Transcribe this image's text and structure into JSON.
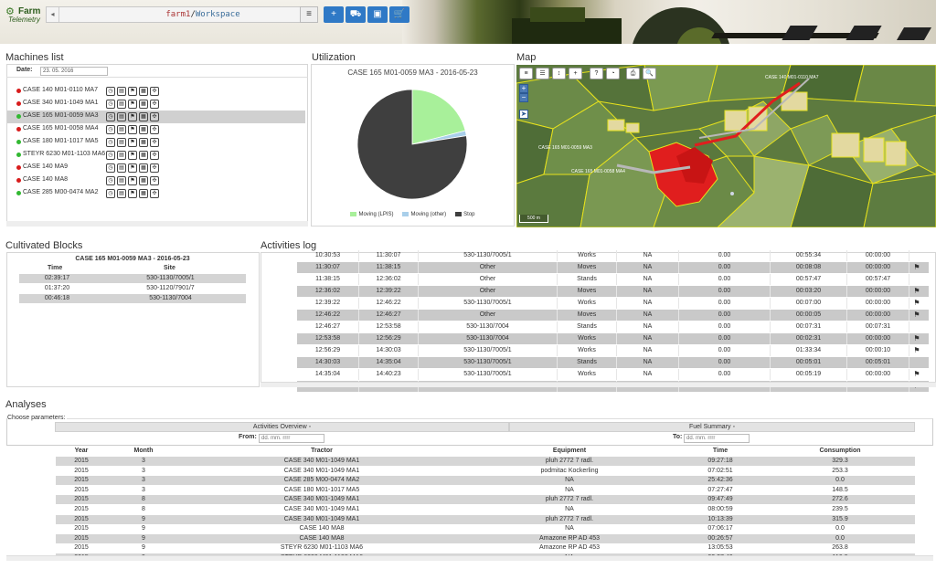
{
  "header": {
    "logo_top": "Farm",
    "logo_bottom": "Telemetry",
    "path_part1": "farm1",
    "path_sep": "/",
    "path_part2": "Workspace",
    "back_glyph": "◂",
    "menu_glyph": "≡",
    "buttons": [
      "+",
      "⛟",
      "▣",
      "🛒"
    ]
  },
  "machines": {
    "title": "Machines list",
    "date_label": "Date:",
    "date_value": "23. 05. 2016",
    "colors": {
      "red": "#d81c1c",
      "green": "#32b832"
    },
    "items": [
      {
        "name": "CASE 140 M01-0110 MA7",
        "status": "red",
        "selected": false
      },
      {
        "name": "CASE 340 M01-1049 MA1",
        "status": "red",
        "selected": false
      },
      {
        "name": "CASE 165 M01-0059 MA3",
        "status": "green",
        "selected": true
      },
      {
        "name": "CASE 165 M01-0058 MA4",
        "status": "red",
        "selected": false
      },
      {
        "name": "CASE 180 M01-1017 MA5",
        "status": "green",
        "selected": false
      },
      {
        "name": "STEYR 6230 M01-1103 MA6",
        "status": "green",
        "selected": false
      },
      {
        "name": "CASE 140 MA9",
        "status": "red",
        "selected": false
      },
      {
        "name": "CASE 140 MA8",
        "status": "red",
        "selected": false
      },
      {
        "name": "CASE 285 M00-0474 MA2",
        "status": "green",
        "selected": false
      }
    ]
  },
  "utilization": {
    "title": "Utilization",
    "chart_title": "CASE 165 M01-0059 MA3 - 2016-05-23"
  },
  "chart_data": {
    "type": "pie",
    "title": "CASE 165 M01-0059 MA3 - 2016-05-23",
    "legend_position": "bottom",
    "slices": [
      {
        "label": "Moving (LPIS)",
        "value": 21,
        "color": "#a8f09a"
      },
      {
        "label": "Moving (other)",
        "value": 1.5,
        "color": "#a9cfea"
      },
      {
        "label": "Stop",
        "value": 77.5,
        "color": "#3f3f3f"
      }
    ]
  },
  "map": {
    "title": "Map",
    "toolbar": [
      "≡",
      "☰",
      "↕",
      "+",
      "?",
      "◔",
      "⎙",
      "🔍"
    ],
    "zoom_in": "+",
    "zoom_out": "−",
    "scale": "500 m",
    "label1": "CASE 165 M01-0059 MA3",
    "label2": "CASE 165 M01-0058 MA4",
    "label3": "CASE 140 M01-0110 MA7"
  },
  "blocks": {
    "title": "Cultivated Blocks",
    "table_title": "CASE 165 M01-0059 MA3 - 2016-05-23",
    "col_time": "Time",
    "col_site": "Site",
    "rows": [
      {
        "time": "02:39:17",
        "site": "530-1130/7005/1"
      },
      {
        "time": "01:37:20",
        "site": "530-1120/7901/7"
      },
      {
        "time": "00:46:18",
        "site": "530-1130/7004"
      }
    ]
  },
  "activities": {
    "title": "Activities log",
    "rows": [
      [
        "10:30:53",
        "11:30:07",
        "530-1130/7005/1",
        "Works",
        "NA",
        "0.00",
        "00:55:34",
        "00:00:00",
        ""
      ],
      [
        "11:30:07",
        "11:38:15",
        "Other",
        "Moves",
        "NA",
        "0.00",
        "00:08:08",
        "00:00:00",
        "⚑"
      ],
      [
        "11:38:15",
        "12:36:02",
        "Other",
        "Stands",
        "NA",
        "0.00",
        "00:57:47",
        "00:57:47",
        ""
      ],
      [
        "12:36:02",
        "12:39:22",
        "Other",
        "Moves",
        "NA",
        "0.00",
        "00:03:20",
        "00:00:00",
        "⚑"
      ],
      [
        "12:39:22",
        "12:46:22",
        "530-1130/7005/1",
        "Works",
        "NA",
        "0.00",
        "00:07:00",
        "00:00:00",
        "⚑"
      ],
      [
        "12:46:22",
        "12:46:27",
        "Other",
        "Moves",
        "NA",
        "0.00",
        "00:00:05",
        "00:00:00",
        "⚑"
      ],
      [
        "12:46:27",
        "12:53:58",
        "530-1130/7004",
        "Stands",
        "NA",
        "0.00",
        "00:07:31",
        "00:07:31",
        ""
      ],
      [
        "12:53:58",
        "12:56:29",
        "530-1130/7004",
        "Works",
        "NA",
        "0.00",
        "00:02:31",
        "00:00:00",
        "⚑"
      ],
      [
        "12:56:29",
        "14:30:03",
        "530-1130/7005/1",
        "Works",
        "NA",
        "0.00",
        "01:33:34",
        "00:00:10",
        "⚑"
      ],
      [
        "14:30:03",
        "14:35:04",
        "530-1130/7005/1",
        "Stands",
        "NA",
        "0.00",
        "00:05:01",
        "00:05:01",
        ""
      ],
      [
        "14:35:04",
        "14:40:23",
        "530-1130/7005/1",
        "Works",
        "NA",
        "0.00",
        "00:05:19",
        "00:00:00",
        "⚑"
      ],
      [
        "14:40:23",
        "14:48:48",
        "Other",
        "Moves",
        "NA",
        "0.00",
        "00:08:25",
        "00:00:00",
        "⚑"
      ]
    ]
  },
  "analyses": {
    "title": "Analyses",
    "choose": "Choose parameters:",
    "tab1": "Activities Overview",
    "tab2": "Fuel Summary",
    "from_label": "From:",
    "to_label": "To:",
    "from_placeholder": "dd. mm. rrrr",
    "to_placeholder": "dd. mm. rrrr",
    "columns": [
      "Year",
      "Month",
      "Tractor",
      "Equipment",
      "Time",
      "Consumption"
    ],
    "rows": [
      [
        "2015",
        "3",
        "CASE 340 M01-1049 MA1",
        "pluh 2772 7 radl.",
        "09:27:18",
        "329.3"
      ],
      [
        "2015",
        "3",
        "CASE 340 M01-1049 MA1",
        "podmitac Kockerling",
        "07:02:51",
        "253.3"
      ],
      [
        "2015",
        "3",
        "CASE 285 M00-0474 MA2",
        "NA",
        "25:42:36",
        "0.0"
      ],
      [
        "2015",
        "3",
        "CASE 180 M01-1017 MA5",
        "NA",
        "07:27:47",
        "148.5"
      ],
      [
        "2015",
        "8",
        "CASE 340 M01-1049 MA1",
        "pluh 2772 7 radl.",
        "09:47:49",
        "272.6"
      ],
      [
        "2015",
        "8",
        "CASE 340 M01-1049 MA1",
        "NA",
        "08:00:59",
        "239.5"
      ],
      [
        "2015",
        "9",
        "CASE 340 M01-1049 MA1",
        "pluh 2772 7 radl.",
        "10:13:39",
        "315.9"
      ],
      [
        "2015",
        "9",
        "CASE 140 MA8",
        "NA",
        "07:06:17",
        "0.0"
      ],
      [
        "2015",
        "9",
        "CASE 140 MA8",
        "Amazone RP AD 453",
        "00:26:57",
        "0.0"
      ],
      [
        "2015",
        "9",
        "STEYR 6230 M01-1103 MA6",
        "Amazone RP AD 453",
        "13:05:53",
        "263.8"
      ],
      [
        "2015",
        "9",
        "STEYR 6230 M01-1103 MA6",
        "NA",
        "02:27:40",
        "116.0"
      ]
    ]
  }
}
